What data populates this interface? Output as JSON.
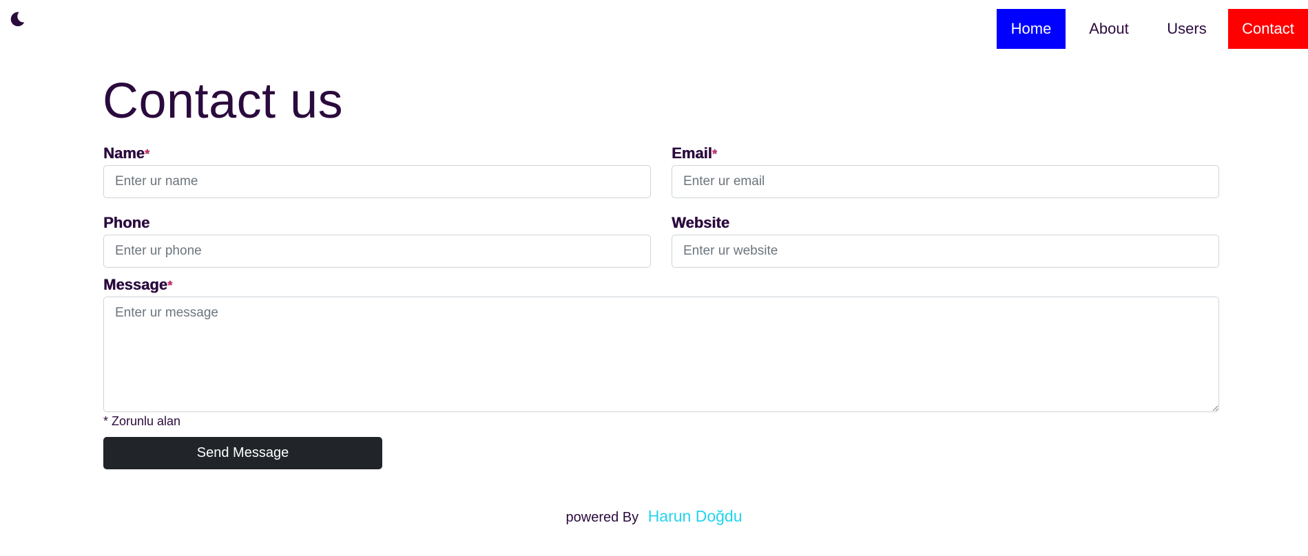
{
  "theme_toggle": {
    "icon": "moon-icon"
  },
  "nav": {
    "home": "Home",
    "about": "About",
    "users": "Users",
    "contact": "Contact",
    "colors": {
      "home_bg": "#0000ff",
      "contact_bg": "#ff0000"
    }
  },
  "page": {
    "title": "Contact us"
  },
  "form": {
    "name": {
      "label": "Name",
      "required_mark": "*",
      "placeholder": "Enter ur name",
      "value": ""
    },
    "email": {
      "label": "Email",
      "required_mark": "*",
      "placeholder": "Enter ur email",
      "value": ""
    },
    "phone": {
      "label": "Phone",
      "placeholder": "Enter ur phone",
      "value": ""
    },
    "website": {
      "label": "Website",
      "placeholder": "Enter ur website",
      "value": ""
    },
    "message": {
      "label": "Message",
      "required_mark": "*",
      "placeholder": "Enter ur message",
      "value": ""
    },
    "required_note": "* Zorunlu alan",
    "submit_label": "Send Message"
  },
  "footer": {
    "text": "powered By",
    "author": "Harun Doğdu",
    "author_color": "#22d3ee"
  }
}
